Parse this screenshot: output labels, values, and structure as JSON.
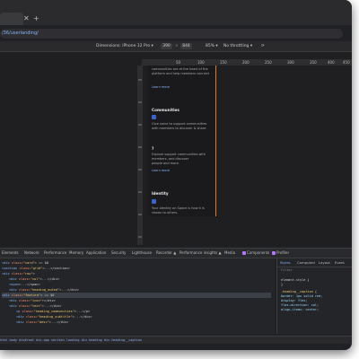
{
  "browser": {
    "address": "/36/userlanding/",
    "tab_icons": [
      "close-icon",
      "add-tab-icon"
    ]
  },
  "device_toolbar": {
    "dimensions_label": "Dimensions: iPhone 12 Pro ▾",
    "width": "390",
    "times": "×",
    "height": "844",
    "zoom": "85% ▾",
    "throttle": "No throttling ▾"
  },
  "ruler": {
    "ticks": [
      "50",
      "100",
      "150",
      "200",
      "250",
      "300",
      "350",
      "400",
      "450"
    ]
  },
  "phone_content": {
    "intro_line1": "communities are at the heart of the",
    "intro_line2": "platform and help members connect",
    "learn_more_1": "Learn more",
    "section1_title": "Communities",
    "section1_line1": "Give voice to support communities",
    "section1_line2": "with members to discover & share.",
    "section2_title": "?",
    "section2_line1": "Explore support communities with",
    "section2_line2": "members, and discover",
    "section2_line3": "people and more.",
    "learn_more_2": "Learn more",
    "section3_title": "Identity",
    "section3_line1": "Your identity on Space is how it is",
    "section3_line2": "shown to others."
  },
  "devtools_tabs": [
    "Elements",
    "Network",
    "Performance",
    "Memory",
    "Application",
    "Security",
    "Lighthouse",
    "Recorder ▲",
    "Performance insights ▲",
    "Media",
    "Components",
    "Profiler"
  ],
  "elements_lines": [
    {
      "tag": "<div",
      "attr": " class=",
      "val": "\"card\"",
      "txt": "> == $0"
    },
    {
      "tag": "<section",
      "attr": " class=",
      "val": "\"grid\"",
      "txt": ">...</section>"
    },
    {
      "tag": "<div",
      "attr": " class=",
      "val": "\"row\"",
      "txt": ">"
    },
    {
      "tag": "<div",
      "attr": " class=",
      "val": "\"col\"",
      "txt": ">...</div>"
    },
    {
      "tag": "<span",
      "attr": "",
      "val": "",
      "txt": ">...</span>"
    },
    {
      "tag": "<div",
      "attr": " class=",
      "val": "\"heading_muted\"",
      "txt": ">...</div>"
    },
    {
      "tag": "<div",
      "attr": " class=",
      "val": "\"feature\"",
      "txt": "> == $0"
    },
    {
      "tag": "<div",
      "attr": " class=",
      "val": "\"icon\"",
      "txt": "></div>"
    },
    {
      "tag": "<div",
      "attr": " class=",
      "val": "\"text\"",
      "txt": ">...</div>"
    },
    {
      "tag": "<p",
      "attr": " class=",
      "val": "\"heading_communities\"",
      "txt": ">...</p>"
    },
    {
      "tag": "<div",
      "attr": " class=",
      "val": "\"heading_subtitle\"",
      "txt": ">...</div>"
    },
    {
      "tag": "<div",
      "attr": " class=",
      "val": "\"desc\"",
      "txt": ">...</div>"
    }
  ],
  "styles_panel": {
    "tabs": [
      "Styles",
      "Computed",
      "Layout",
      "Event"
    ],
    "filter": "Filter",
    "lines": [
      "element.style {",
      "}",
      ".heading__caption {",
      "  border: 1px solid red;",
      "  display: flex;",
      "  flex-direction: col;",
      "  align-items: center;"
    ]
  },
  "breadcrumb": "html  body  div#root  div.app  section.landing  div.heading  div.heading__caption"
}
